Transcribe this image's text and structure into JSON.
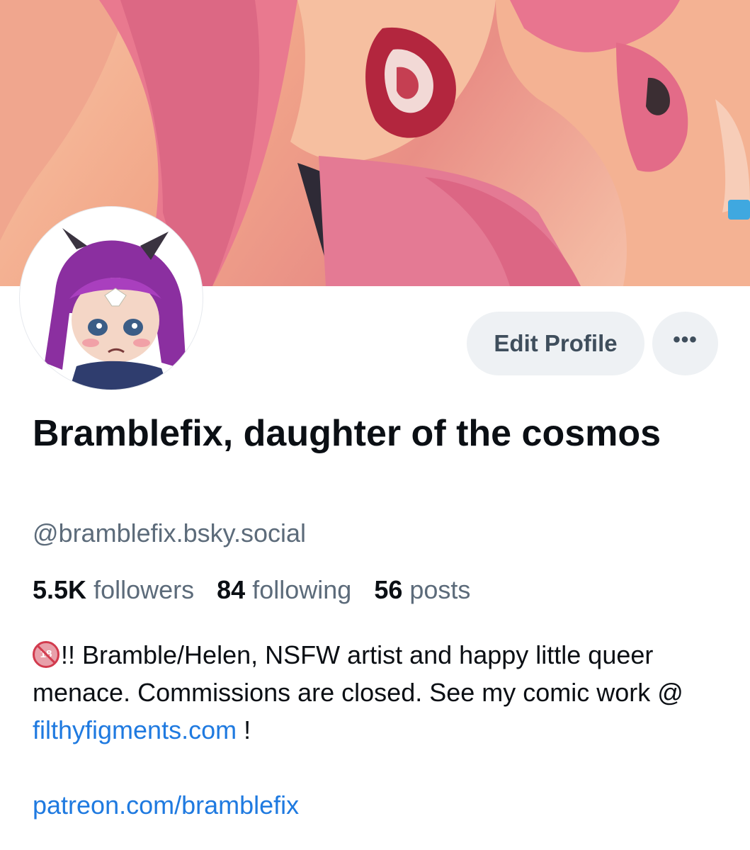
{
  "profile": {
    "display_name": "Bramblefix, daughter of the cosmos",
    "handle": "@bramblefix.bsky.social",
    "stats": {
      "followers_count": "5.5K",
      "followers_label": "followers",
      "following_count": "84",
      "following_label": "following",
      "posts_count": "56",
      "posts_label": "posts"
    },
    "bio": {
      "badge_text": "18",
      "text_before_link": "!! Bramble/Helen, NSFW artist and happy little queer menace. Commissions are closed. See my comic work @ ",
      "link_text": "filthyfigments.com",
      "text_after_link": " !",
      "patreon_link": "patreon.com/bramblefix"
    }
  },
  "actions": {
    "edit_profile_label": "Edit Profile",
    "more_label": "•••"
  },
  "icons": {
    "more": "more-horizontal-icon",
    "nsfw": "no-under-18-icon"
  },
  "colors": {
    "link": "#1f7ae0",
    "button_bg": "#eef1f4",
    "muted_text": "#5c6b7a"
  }
}
